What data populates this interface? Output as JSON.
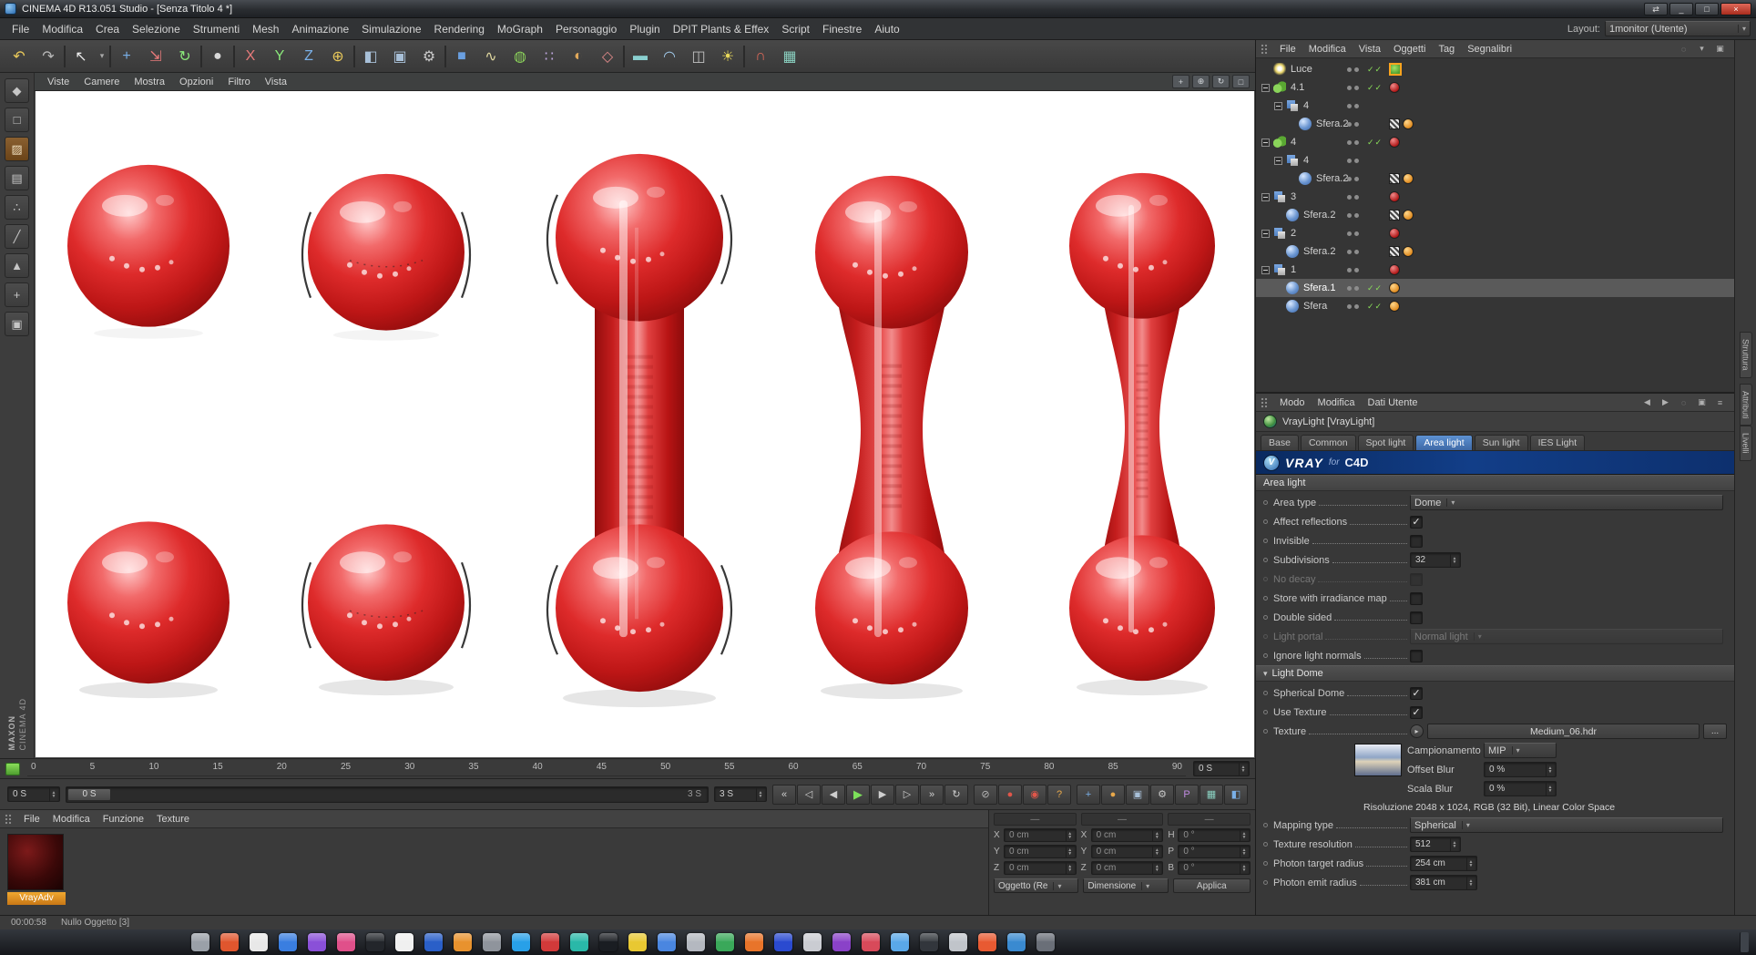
{
  "window": {
    "title": "CINEMA 4D R13.051 Studio - [Senza Titolo 4 *]",
    "controls": {
      "extra": "⇄",
      "min": "_",
      "max": "□",
      "close": "×"
    }
  },
  "menubar": {
    "items": [
      "File",
      "Modifica",
      "Crea",
      "Selezione",
      "Strumenti",
      "Mesh",
      "Animazione",
      "Simulazione",
      "Rendering",
      "MoGraph",
      "Personaggio",
      "Plugin",
      "DPIT Plants & Effex",
      "Script",
      "Finestre",
      "Aiuto"
    ],
    "layout_label": "Layout:",
    "layout_value": "1monitor (Utente)"
  },
  "toolbar": {
    "buttons": [
      {
        "n": "undo-icon",
        "g": "↶",
        "c": "#e8c85a"
      },
      {
        "n": "redo-icon",
        "g": "↷",
        "c": "#b8b8b8"
      },
      {
        "cls": "sep"
      },
      {
        "n": "live-selection-icon",
        "g": "↖",
        "c": "#ececec"
      },
      {
        "n": "selection-dropdown-icon",
        "g": "▾",
        "c": "#a8a8a8",
        "cls": "narrow"
      },
      {
        "cls": "sep"
      },
      {
        "n": "move-icon",
        "g": "+",
        "c": "#7ab0e8"
      },
      {
        "n": "scale-icon",
        "g": "⇲",
        "c": "#e87a7a"
      },
      {
        "n": "rotate-icon",
        "g": "↻",
        "c": "#8ae87a"
      },
      {
        "cls": "sep"
      },
      {
        "n": "last-tool-icon",
        "g": "●",
        "c": "#d8d8d8"
      },
      {
        "cls": "sep"
      },
      {
        "n": "lock-x-icon",
        "g": "X",
        "c": "#e87a7a"
      },
      {
        "n": "lock-y-icon",
        "g": "Y",
        "c": "#8ae87a"
      },
      {
        "n": "lock-z-icon",
        "g": "Z",
        "c": "#7ab0e8"
      },
      {
        "n": "coord-system-icon",
        "g": "⊕",
        "c": "#e8c85a"
      },
      {
        "cls": "sep"
      },
      {
        "n": "render-view-icon",
        "g": "◧",
        "c": "#a8c0d8"
      },
      {
        "n": "render-picture-viewer-icon",
        "g": "▣",
        "c": "#a8c0d8"
      },
      {
        "n": "render-settings-icon",
        "g": "⚙",
        "c": "#c8c8c8"
      },
      {
        "cls": "sep"
      },
      {
        "n": "add-cube-icon",
        "g": "■",
        "c": "#6a9fe0"
      },
      {
        "n": "spline-pen-icon",
        "g": "∿",
        "c": "#e0d8a0"
      },
      {
        "n": "subdivision-surface-icon",
        "g": "◍",
        "c": "#8ad05a"
      },
      {
        "n": "array-icon",
        "g": "∷",
        "c": "#c0a8e0"
      },
      {
        "n": "boole-icon",
        "g": "◐",
        "c": "#e0a85a"
      },
      {
        "n": "instance-icon",
        "g": "◇",
        "c": "#e08a8a"
      },
      {
        "cls": "sep"
      },
      {
        "n": "floor-icon",
        "g": "▬",
        "c": "#8ad0d0"
      },
      {
        "n": "sky-icon",
        "g": "◠",
        "c": "#a0c8e8"
      },
      {
        "n": "camera-icon",
        "g": "◫",
        "c": "#c0c0c0"
      },
      {
        "n": "light-icon",
        "g": "☀",
        "c": "#e8d85a"
      },
      {
        "cls": "sep"
      },
      {
        "n": "snap-icon",
        "g": "∩",
        "c": "#e06a5a"
      },
      {
        "n": "workplane-icon",
        "g": "▦",
        "c": "#8ad0c0"
      }
    ]
  },
  "left_tools": {
    "buttons": [
      {
        "n": "make-editable-icon",
        "g": "◆"
      },
      {
        "n": "model-mode-icon",
        "g": "□"
      },
      {
        "n": "texture-mode-icon",
        "g": "▨",
        "cls": "active"
      },
      {
        "n": "workplane-mode-icon",
        "g": "▤"
      },
      {
        "n": "points-mode-icon",
        "g": "∴"
      },
      {
        "n": "edges-mode-icon",
        "g": "╱"
      },
      {
        "n": "polygons-mode-icon",
        "g": "▲"
      },
      {
        "n": "axis-mode-icon",
        "g": "+"
      },
      {
        "n": "viewport-lock-icon",
        "g": "▣"
      }
    ]
  },
  "viewport": {
    "menus": [
      "Viste",
      "Camere",
      "Mostra",
      "Opzioni",
      "Filtro",
      "Vista"
    ],
    "nav": [
      {
        "n": "pan-view-icon",
        "g": "+"
      },
      {
        "n": "zoom-view-icon",
        "g": "⊕"
      },
      {
        "n": "rotate-view-icon",
        "g": "↻"
      },
      {
        "n": "maximize-view-icon",
        "g": "□"
      }
    ]
  },
  "ruler": {
    "ticks": [
      "0",
      "5",
      "10",
      "15",
      "20",
      "25",
      "30",
      "35",
      "40",
      "45",
      "50",
      "55",
      "60",
      "65",
      "70",
      "75",
      "80",
      "85",
      "90"
    ],
    "current": "0 S"
  },
  "transport": {
    "start": "0 S",
    "range_start": "0 S",
    "range_end": "3 S",
    "end": "3 S",
    "play_buttons": [
      {
        "n": "goto-start-icon",
        "g": "«"
      },
      {
        "n": "prev-key-icon",
        "g": "◁"
      },
      {
        "n": "prev-frame-icon",
        "g": "◀"
      },
      {
        "n": "play-icon",
        "g": "▶",
        "cls": "play"
      },
      {
        "n": "next-frame-icon",
        "g": "▶"
      },
      {
        "n": "next-key-icon",
        "g": "▷"
      },
      {
        "n": "goto-end-icon",
        "g": "»"
      },
      {
        "n": "loop-icon",
        "g": "↻"
      }
    ],
    "record_buttons": [
      {
        "n": "sound-icon",
        "g": "⊘",
        "c": "#b8b8b8"
      },
      {
        "n": "record-icon",
        "g": "●",
        "c": "#e0564a"
      },
      {
        "n": "autokey-icon",
        "g": "◉",
        "c": "#e0564a"
      },
      {
        "n": "help-icon",
        "g": "?",
        "c": "#e8a84a"
      }
    ],
    "right_buttons": [
      {
        "n": "snap-move-icon",
        "g": "+",
        "c": "#7ab0e8"
      },
      {
        "n": "render-region-icon",
        "g": "●",
        "c": "#e8a84a"
      },
      {
        "n": "picture-viewer-icon",
        "g": "▣",
        "c": "#a8c0d8"
      },
      {
        "n": "render-settings-icon",
        "g": "⚙",
        "c": "#c8c8c8"
      },
      {
        "n": "team-render-icon",
        "g": "P",
        "c": "#c08ae0"
      },
      {
        "n": "content-browser-icon",
        "g": "▦",
        "c": "#8ad0c0"
      },
      {
        "n": "display-settings-icon",
        "g": "◧",
        "c": "#7ab0e8"
      }
    ]
  },
  "objects": {
    "menus": [
      "File",
      "Modifica",
      "Vista",
      "Oggetti",
      "Tag",
      "Segnalibri"
    ],
    "tools": [
      {
        "n": "search-icon",
        "g": "◌"
      },
      {
        "n": "filter-icon",
        "g": "▾"
      },
      {
        "n": "panel-menu-icon",
        "g": "▣"
      }
    ],
    "rows": [
      {
        "label": "Luce",
        "ind": "i0",
        "icon": "light",
        "marks": "✓✓",
        "t1": "tsel"
      },
      {
        "label": "4.1",
        "ind": "i0",
        "icon": "meta",
        "exp": "minus",
        "marks": "✓✓",
        "t1": "mat"
      },
      {
        "label": "4",
        "ind": "i1",
        "icon": "bool",
        "exp": "minus"
      },
      {
        "label": "Sfera.2",
        "ind": "i2",
        "icon": "prim",
        "t1": "chk",
        "t2": "odot"
      },
      {
        "label": "4",
        "ind": "i0",
        "icon": "meta",
        "exp": "minus",
        "marks": "✓✓",
        "t1": "mat"
      },
      {
        "label": "4",
        "ind": "i1",
        "icon": "bool",
        "exp": "minus"
      },
      {
        "label": "Sfera.2",
        "ind": "i2",
        "icon": "prim",
        "t1": "chk",
        "t2": "odot"
      },
      {
        "label": "3",
        "ind": "i0",
        "icon": "bool",
        "exp": "minus",
        "t1": "mat"
      },
      {
        "label": "Sfera.2",
        "ind": "i1",
        "icon": "prim",
        "t1": "chk",
        "t2": "odot"
      },
      {
        "label": "2",
        "ind": "i0",
        "icon": "bool",
        "exp": "minus",
        "t1": "mat"
      },
      {
        "label": "Sfera.2",
        "ind": "i1",
        "icon": "prim",
        "t1": "chk",
        "t2": "odot"
      },
      {
        "label": "1",
        "ind": "i0",
        "icon": "bool",
        "exp": "minus",
        "t1": "mat"
      },
      {
        "label": "Sfera.1",
        "ind": "i1",
        "icon": "sph",
        "cls": "sel",
        "marks": "✓✓",
        "t1": "odot"
      },
      {
        "label": "Sfera",
        "ind": "i1",
        "icon": "sph",
        "marks": "✓✓",
        "t1": "odot"
      }
    ]
  },
  "attrs": {
    "menus": [
      "Modo",
      "Modifica",
      "Dati Utente"
    ],
    "tools": [
      {
        "n": "history-back-icon",
        "g": "◀"
      },
      {
        "n": "history-forward-icon",
        "g": "▶"
      },
      {
        "n": "search-icon",
        "g": "◌"
      },
      {
        "n": "lock-icon",
        "g": "▣"
      },
      {
        "n": "panel-menu-icon",
        "g": "≡"
      }
    ],
    "title": "VrayLight [VrayLight]",
    "tabs": [
      {
        "label": "Base"
      },
      {
        "label": "Common"
      },
      {
        "label": "Spot light"
      },
      {
        "label": "Area light",
        "cls": "active"
      },
      {
        "label": "Sun light"
      },
      {
        "label": "IES Light"
      }
    ],
    "banner": {
      "v": "VRAY",
      "f": "for",
      "c": "C4D",
      "logo": "V"
    },
    "sections": {
      "area": "Area light",
      "dome": "Light Dome"
    },
    "area_type": {
      "label": "Area type",
      "value": "Dome"
    },
    "affect_reflections": {
      "label": "Affect reflections",
      "checked": "✓"
    },
    "invisible": {
      "label": "Invisible"
    },
    "subdivisions": {
      "label": "Subdivisions",
      "value": "32"
    },
    "no_decay": {
      "label": "No decay"
    },
    "store_irradiance": {
      "label": "Store with irradiance map"
    },
    "double_sided": {
      "label": "Double sided"
    },
    "light_portal": {
      "label": "Light portal",
      "value": "Normal light"
    },
    "ignore_normals": {
      "label": "Ignore light normals"
    },
    "spherical_dome": {
      "label": "Spherical Dome",
      "checked": "✓"
    },
    "use_texture": {
      "label": "Use Texture",
      "checked": "✓"
    },
    "texture": {
      "label": "Texture",
      "value": "Medium_06.hdr",
      "browse": "...",
      "expand": "▸"
    },
    "campionamento": {
      "label": "Campionamento",
      "value": "MIP"
    },
    "offset_blur": {
      "label": "Offset Blur",
      "value": "0 %"
    },
    "scala_blur": {
      "label": "Scala Blur",
      "value": "0 %"
    },
    "resolution_info": "Risoluzione 2048 x 1024, RGB (32 Bit), Linear Color Space",
    "mapping_type": {
      "label": "Mapping type",
      "value": "Spherical"
    },
    "texture_resolution": {
      "label": "Texture resolution",
      "value": "512"
    },
    "photon_target": {
      "label": "Photon target radius",
      "value": "254 cm"
    },
    "photon_emit": {
      "label": "Photon emit radius",
      "value": "381 cm"
    }
  },
  "materials": {
    "menus": [
      "File",
      "Modifica",
      "Funzione",
      "Texture"
    ],
    "items": [
      {
        "name": "VrayAdv"
      }
    ]
  },
  "coords": {
    "headers": [
      "—",
      "—",
      "—"
    ],
    "rows": [
      {
        "a": "X",
        "av": "0 cm",
        "b": "X",
        "bv": "0 cm",
        "c": "H",
        "cv": "0 °"
      },
      {
        "a": "Y",
        "av": "0 cm",
        "b": "Y",
        "bv": "0 cm",
        "c": "P",
        "cv": "0 °"
      },
      {
        "a": "Z",
        "av": "0 cm",
        "b": "Z",
        "bv": "0 cm",
        "c": "B",
        "cv": "0 °"
      }
    ],
    "mode1": "Oggetto (Re",
    "mode2": "Dimensione",
    "apply": "Applica"
  },
  "status": {
    "time": "00:00:58",
    "message": "Nullo Oggetto [3]"
  },
  "side_tabs": [
    "Struttura",
    "Attributi",
    "Livelli"
  ],
  "brand": {
    "maxon": "MAXON",
    "cinema": "CINEMA 4D"
  },
  "taskbar": {
    "icons": [
      {
        "c": "#9aa0a8"
      },
      {
        "c": "#e0562e"
      },
      {
        "c": "#e8e8e8"
      },
      {
        "c": "#3a7ee0"
      },
      {
        "c": "#8a50d8"
      },
      {
        "c": "#e0508a"
      },
      {
        "c": "#23262b"
      },
      {
        "c": "#f0f0f0"
      },
      {
        "c": "#2a5fc8"
      },
      {
        "c": "#e8922e"
      },
      {
        "c": "#8f949c"
      },
      {
        "c": "#28a0e8"
      },
      {
        "c": "#d23a3a"
      },
      {
        "c": "#2ab8a8"
      },
      {
        "c": "#1a1d22"
      },
      {
        "c": "#e8c832"
      },
      {
        "c": "#4a86e0"
      },
      {
        "c": "#b4b8c0"
      },
      {
        "c": "#3aa85a"
      },
      {
        "c": "#e8742a"
      },
      {
        "c": "#2a4ad0"
      },
      {
        "c": "#caccd2"
      },
      {
        "c": "#8a42c8"
      },
      {
        "c": "#d84a5a"
      },
      {
        "c": "#5aa8e8"
      },
      {
        "c": "#32363c"
      },
      {
        "c": "#c0c4ca"
      },
      {
        "c": "#e85a32"
      },
      {
        "c": "#3a8ad0"
      },
      {
        "c": "#6a6f78"
      }
    ]
  }
}
